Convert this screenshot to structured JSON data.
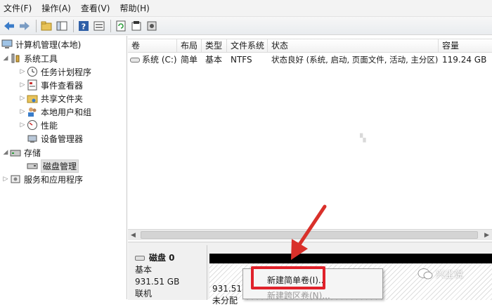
{
  "menubar": {
    "items": [
      "文件(F)",
      "操作(A)",
      "查看(V)",
      "帮助(H)"
    ]
  },
  "toolbar": {
    "buttons": [
      "back-arrow-icon",
      "forward-arrow-icon",
      "up-folder-icon",
      "show-hide-tree-icon",
      "help-icon",
      "properties-icon",
      "refresh-icon",
      "export-icon",
      "settings-icon"
    ]
  },
  "tree": {
    "root": "计算机管理(本地)",
    "system_tools": "系统工具",
    "task_scheduler": "任务计划程序",
    "event_viewer": "事件查看器",
    "shared_folders": "共享文件夹",
    "local_users": "本地用户和组",
    "performance": "性能",
    "device_manager": "设备管理器",
    "storage": "存储",
    "disk_management": "磁盘管理",
    "services": "服务和应用程序"
  },
  "table": {
    "columns": [
      "卷",
      "布局",
      "类型",
      "文件系统",
      "状态",
      "容量"
    ],
    "rows": [
      {
        "volume": "系统 (C:)",
        "layout": "简单",
        "type": "基本",
        "fs": "NTFS",
        "status": "状态良好 (系统, 启动, 页面文件, 活动, 主分区)",
        "capacity": "119.24 GB"
      }
    ]
  },
  "disk": {
    "name": "磁盘 0",
    "type": "基本",
    "size": "931.51 GB",
    "status": "联机",
    "partition_size": "931.51",
    "partition_state": "未分配"
  },
  "context_menu": {
    "items": [
      {
        "label": "新建简单卷(I)...",
        "enabled": true
      },
      {
        "label": "新建跨区卷(N)...",
        "enabled": false
      }
    ]
  },
  "watermark": {
    "text": "兴尘说"
  },
  "colors": {
    "highlight_red": "#e0222b",
    "arrow_red": "#d9302a"
  }
}
